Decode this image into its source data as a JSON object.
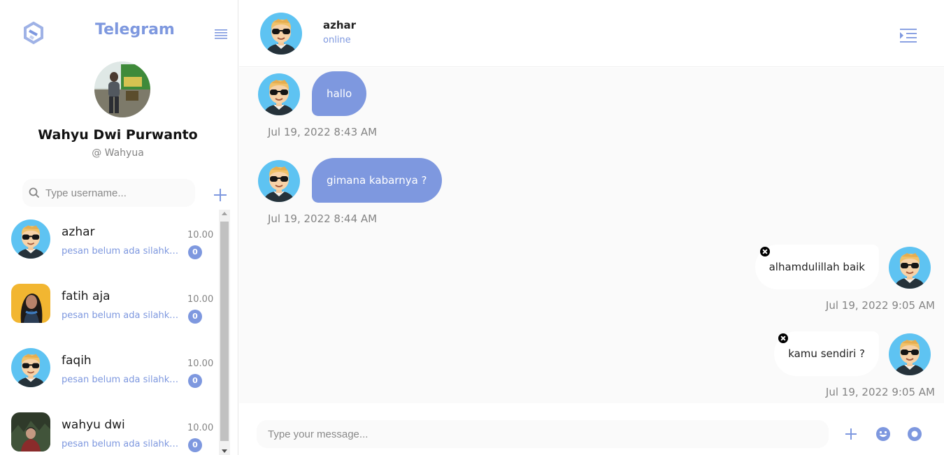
{
  "app": {
    "title": "Telegram"
  },
  "profile": {
    "name": "Wahyu Dwi Purwanto",
    "username": "@ Wahyua"
  },
  "search": {
    "placeholder": "Type username..."
  },
  "contacts": [
    {
      "name": "azhar",
      "preview": "pesan belum ada silahkan kirim pesan",
      "time": "10.00",
      "unread": "0",
      "avatar": "cartoon-avatar"
    },
    {
      "name": "fatih aja",
      "preview": "pesan belum ada silahkan kirim pesan",
      "time": "10.00",
      "unread": "0",
      "avatar": "photo-avatar"
    },
    {
      "name": "faqih",
      "preview": "pesan belum ada silahkan kirim pesan",
      "time": "10.00",
      "unread": "0",
      "avatar": "cartoon-avatar"
    },
    {
      "name": "wahyu dwi",
      "preview": "pesan belum ada silahkan kirim pesan",
      "time": "10.00",
      "unread": "0",
      "avatar": "photo-avatar"
    }
  ],
  "chat": {
    "name": "azhar",
    "status": "online",
    "messages": [
      {
        "direction": "in",
        "text": "hallo",
        "time": "Jul 19, 2022 8:43 AM"
      },
      {
        "direction": "in",
        "text": "gimana kabarnya ?",
        "time": "Jul 19, 2022 8:44 AM"
      },
      {
        "direction": "out",
        "text": "alhamdulillah baik",
        "time": "Jul 19, 2022 9:05 AM"
      },
      {
        "direction": "out",
        "text": "kamu sendiri ?",
        "time": "Jul 19, 2022 9:05 AM"
      }
    ]
  },
  "composer": {
    "placeholder": "Type your message..."
  },
  "colors": {
    "accent": "#7e98df",
    "bubble_out": "#ffffff",
    "chat_bg": "#fafafa",
    "badge": "#7e98df"
  },
  "icons": [
    "logo-icon",
    "menu-icon",
    "search-icon",
    "plus-icon",
    "chat-menu-icon",
    "delete-icon",
    "emoji-icon",
    "record-icon"
  ]
}
